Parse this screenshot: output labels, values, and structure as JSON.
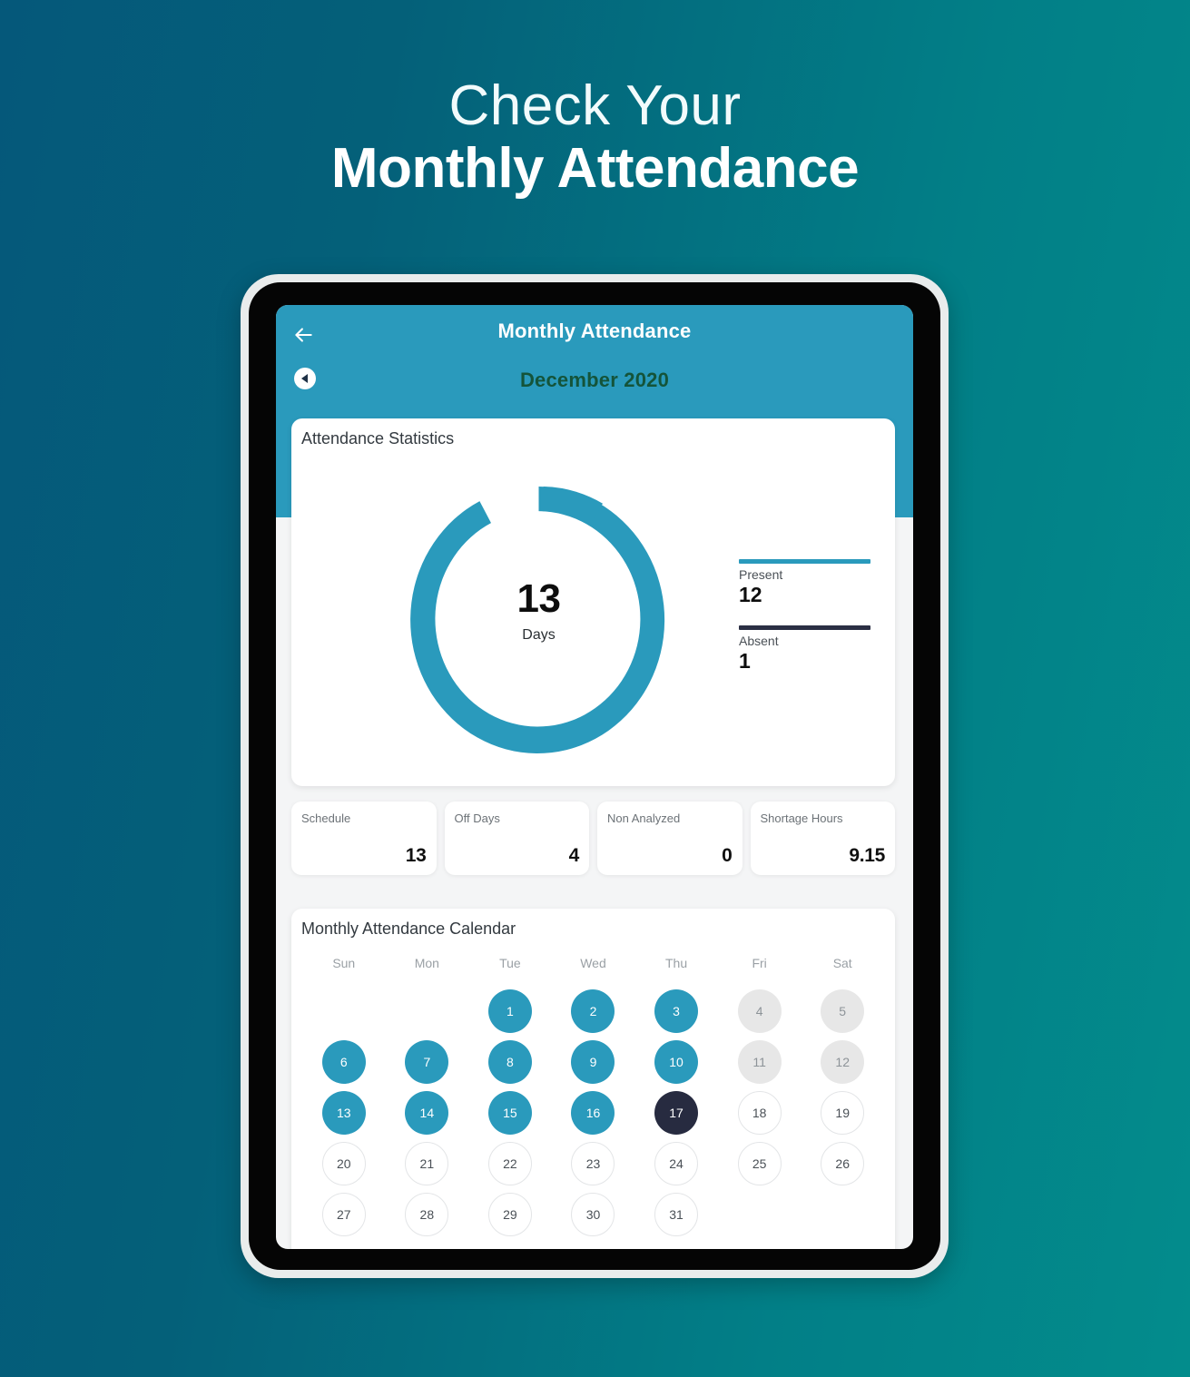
{
  "promo": {
    "line1": "Check Your",
    "line2": "Monthly Attendance"
  },
  "app": {
    "header": {
      "back_icon": "arrow-left-icon",
      "title": "Monthly Attendance",
      "prev_icon": "circle-caret-left-icon",
      "month": "December 2020"
    },
    "stats": {
      "title": "Attendance Statistics",
      "center_value": "13",
      "center_label": "Days",
      "legend": [
        {
          "name": "Present",
          "value": "12",
          "color": "#2a9abc"
        },
        {
          "name": "Absent",
          "value": "1",
          "color": "#2b2f44"
        }
      ]
    },
    "tiles": [
      {
        "label": "Schedule",
        "value": "13"
      },
      {
        "label": "Off Days",
        "value": "4"
      },
      {
        "label": "Non Analyzed",
        "value": "0"
      },
      {
        "label": "Shortage Hours",
        "value": "9.15"
      }
    ],
    "calendar": {
      "title": "Monthly Attendance Calendar",
      "weekdays": [
        "Sun",
        "Mon",
        "Tue",
        "Wed",
        "Thu",
        "Fri",
        "Sat"
      ],
      "days": [
        {
          "label": "",
          "state": "empty"
        },
        {
          "label": "",
          "state": "empty"
        },
        {
          "label": "1",
          "state": "present"
        },
        {
          "label": "2",
          "state": "present"
        },
        {
          "label": "3",
          "state": "present"
        },
        {
          "label": "4",
          "state": "off"
        },
        {
          "label": "5",
          "state": "off"
        },
        {
          "label": "6",
          "state": "present"
        },
        {
          "label": "7",
          "state": "present"
        },
        {
          "label": "8",
          "state": "present"
        },
        {
          "label": "9",
          "state": "present"
        },
        {
          "label": "10",
          "state": "present"
        },
        {
          "label": "11",
          "state": "off"
        },
        {
          "label": "12",
          "state": "off"
        },
        {
          "label": "13",
          "state": "present"
        },
        {
          "label": "14",
          "state": "present"
        },
        {
          "label": "15",
          "state": "present"
        },
        {
          "label": "16",
          "state": "present"
        },
        {
          "label": "17",
          "state": "today"
        },
        {
          "label": "18",
          "state": "plain"
        },
        {
          "label": "19",
          "state": "plain"
        },
        {
          "label": "20",
          "state": "plain"
        },
        {
          "label": "21",
          "state": "plain"
        },
        {
          "label": "22",
          "state": "plain"
        },
        {
          "label": "23",
          "state": "plain"
        },
        {
          "label": "24",
          "state": "plain"
        },
        {
          "label": "25",
          "state": "plain"
        },
        {
          "label": "26",
          "state": "plain"
        },
        {
          "label": "27",
          "state": "plain"
        },
        {
          "label": "28",
          "state": "plain"
        },
        {
          "label": "29",
          "state": "plain"
        },
        {
          "label": "30",
          "state": "plain"
        },
        {
          "label": "31",
          "state": "plain"
        }
      ]
    }
  },
  "chart_data": {
    "type": "pie",
    "title": "Attendance Statistics",
    "categories": [
      "Present",
      "Absent"
    ],
    "values": [
      12,
      1
    ],
    "total": 13,
    "center_text": "13 Days",
    "colors": [
      "#2a9abc",
      "#2a9abc"
    ],
    "legend_colors": [
      "#2a9abc",
      "#2b2f44"
    ],
    "legend": "right",
    "donut": true,
    "start_angle": 0
  }
}
